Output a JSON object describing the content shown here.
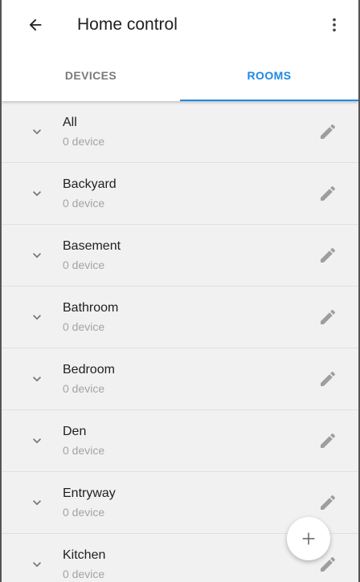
{
  "appbar": {
    "title": "Home control"
  },
  "tabs": [
    {
      "label": "DEVICES",
      "active": false
    },
    {
      "label": "ROOMS",
      "active": true
    }
  ],
  "rooms": [
    {
      "name": "All",
      "count": "0 device"
    },
    {
      "name": "Backyard",
      "count": "0 device"
    },
    {
      "name": "Basement",
      "count": "0 device"
    },
    {
      "name": "Bathroom",
      "count": "0 device"
    },
    {
      "name": "Bedroom",
      "count": "0 device"
    },
    {
      "name": "Den",
      "count": "0 device"
    },
    {
      "name": "Entryway",
      "count": "0 device"
    },
    {
      "name": "Kitchen",
      "count": "0 device"
    }
  ],
  "icons": {
    "back": "arrow-left-icon",
    "more": "more-vert-icon",
    "expand": "chevron-down-icon",
    "edit": "pencil-icon",
    "add": "plus-icon"
  },
  "colors": {
    "accent": "#1e88e5",
    "list_bg": "#f1f1f1",
    "primary_text": "#212121",
    "secondary_text": "#a4a4a4",
    "icon_gray": "#9e9e9e"
  }
}
